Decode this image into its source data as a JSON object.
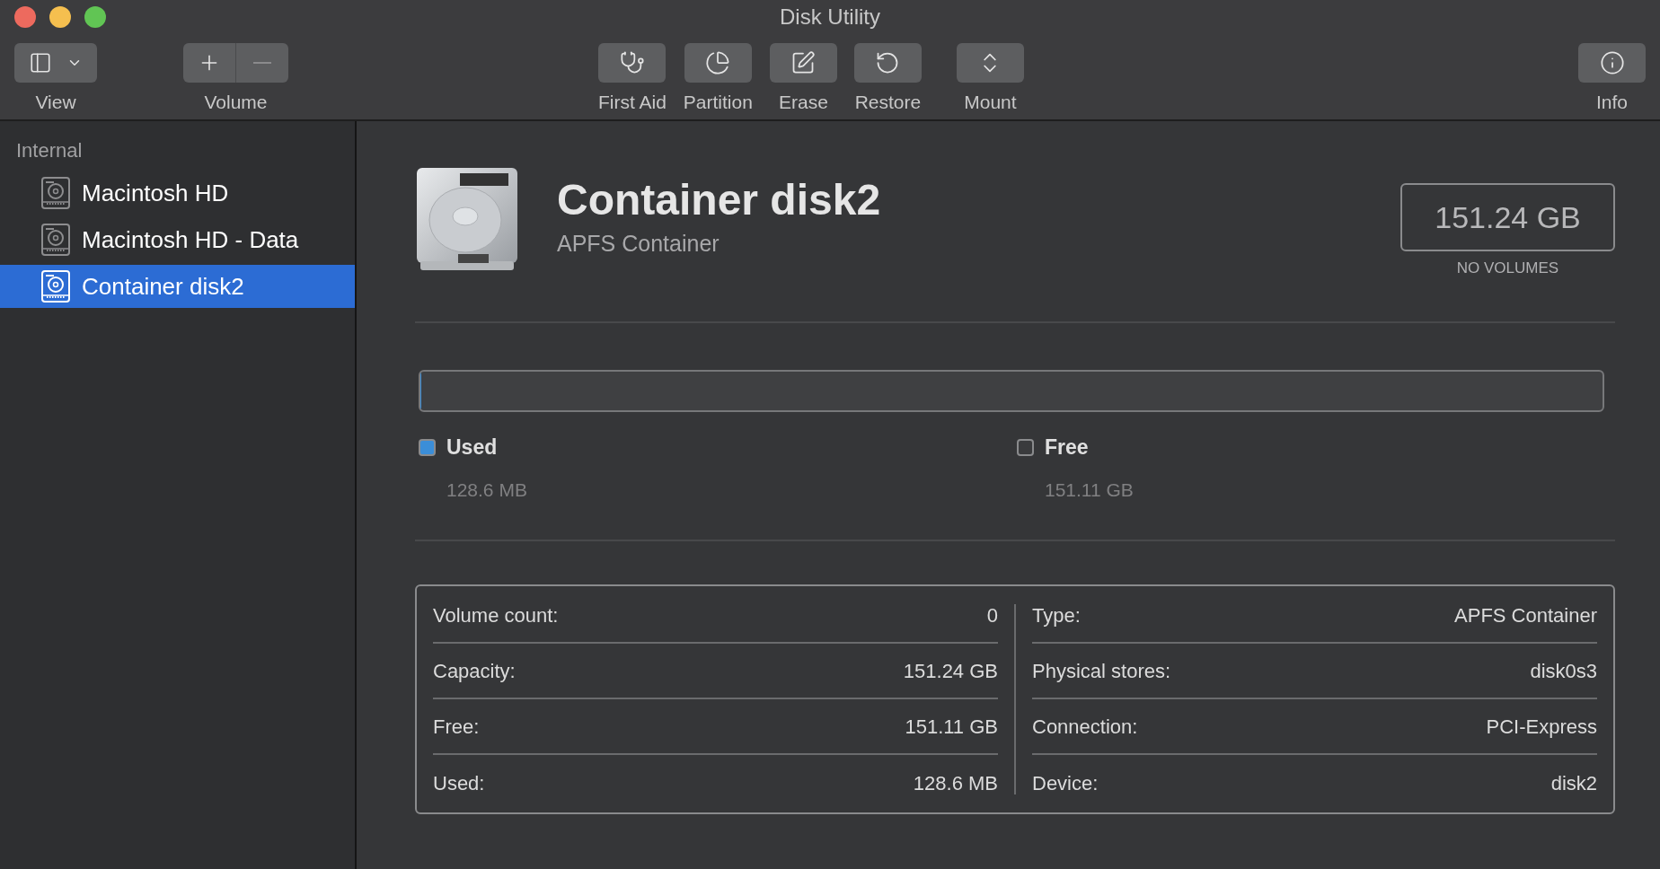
{
  "window": {
    "title": "Disk Utility"
  },
  "toolbar": {
    "groups": [
      {
        "kind": "view",
        "label": "View"
      },
      {
        "kind": "volume",
        "label": "Volume",
        "add_disabled": false,
        "remove_disabled": true
      },
      {
        "kind": "first_aid",
        "label": "First Aid"
      },
      {
        "kind": "partition",
        "label": "Partition"
      },
      {
        "kind": "erase",
        "label": "Erase"
      },
      {
        "kind": "restore",
        "label": "Restore"
      },
      {
        "kind": "mount",
        "label": "Mount"
      },
      {
        "kind": "info",
        "label": "Info"
      }
    ]
  },
  "sidebar": {
    "section": "Internal",
    "items": [
      {
        "label": "Macintosh HD",
        "selected": false
      },
      {
        "label": "Macintosh HD - Data",
        "selected": false
      },
      {
        "label": "Container disk2",
        "selected": true
      }
    ]
  },
  "header": {
    "title": "Container disk2",
    "subtitle": "APFS Container",
    "size": "151.24 GB",
    "size_caption": "NO VOLUMES"
  },
  "usage": {
    "level": 0.001,
    "legend": [
      {
        "label": "Used",
        "value": "128.6 MB",
        "color": "#3b8ed8"
      },
      {
        "label": "Free",
        "value": "151.11 GB",
        "color": "#3a3b3d"
      }
    ]
  },
  "info": {
    "left": [
      {
        "label": "Volume count:",
        "value": "0"
      },
      {
        "label": "Capacity:",
        "value": "151.24 GB"
      },
      {
        "label": "Free:",
        "value": "151.11 GB"
      },
      {
        "label": "Used:",
        "value": "128.6 MB"
      }
    ],
    "right": [
      {
        "label": "Type:",
        "value": "APFS Container"
      },
      {
        "label": "Physical stores:",
        "value": "disk0s3"
      },
      {
        "label": "Connection:",
        "value": "PCI-Express"
      },
      {
        "label": "Device:",
        "value": "disk2"
      }
    ]
  }
}
